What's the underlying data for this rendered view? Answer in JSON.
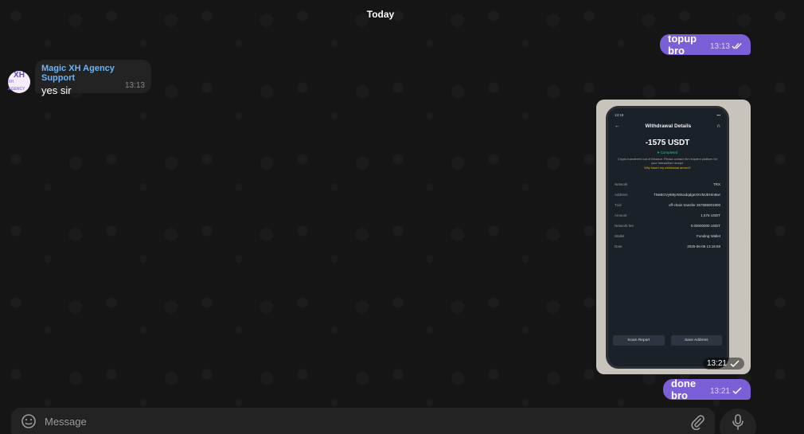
{
  "date_separator": "Today",
  "messages": [
    {
      "direction": "out",
      "text": "topup bro",
      "time": "13:13"
    },
    {
      "direction": "in",
      "sender": "Magic XH Agency Support",
      "text": "yes sir",
      "time": "13:13"
    },
    {
      "direction": "out",
      "type": "photo",
      "time": "13:21"
    },
    {
      "direction": "out",
      "text": "done bro",
      "time": "13:21"
    }
  ],
  "avatar": {
    "initials": "XH",
    "subtitle": "XH AGENCY"
  },
  "photo_content": {
    "status_time": "13:18",
    "title": "Withdrawal Details",
    "amount": "-1575 USDT",
    "status": "Completed",
    "note": "Crypto transferred out of Binance. Please contact the recipient platform for your transaction receipt.",
    "link": "Why hasn't my withdrawal arrived?",
    "rows": [
      {
        "label": "Network",
        "value": "TRX"
      },
      {
        "label": "Address",
        "value": "TNeBGVy6i8yXMoxdqdge3XVMJEHm6wr"
      },
      {
        "label": "Txid",
        "value": "off-chain transfer 267585001900"
      },
      {
        "label": "Amount",
        "value": "1,575 USDT"
      },
      {
        "label": "Network fee",
        "value": "0.00000000 USDT"
      },
      {
        "label": "Wallet",
        "value": "Funding Wallet"
      },
      {
        "label": "Date",
        "value": "2025-06-08 13:16:59"
      }
    ],
    "buttons": [
      "Scam Report",
      "Save Address"
    ]
  },
  "composer": {
    "placeholder": "Message"
  },
  "colors": {
    "outgoing_bubble": "#7b5fd6",
    "incoming_bubble": "#232323",
    "sender_name": "#6cb4f5",
    "background": "#151515"
  }
}
